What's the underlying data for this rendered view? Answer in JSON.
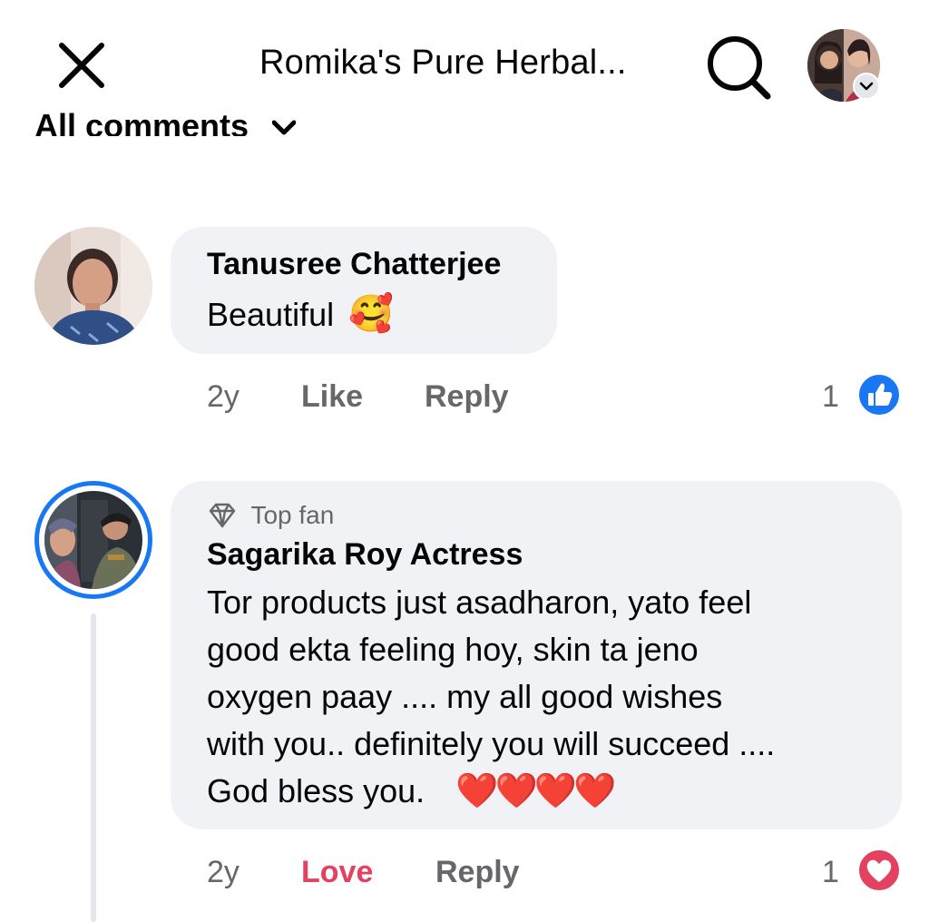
{
  "header": {
    "title": "Romika's Pure Herbal...",
    "filter_label": "All comments"
  },
  "comments": [
    {
      "author": "Tanusree Chatterjee",
      "text": "Beautiful",
      "emoji": "🥰",
      "time": "2y",
      "action": "Like",
      "reply": "Reply",
      "reaction_count": "1",
      "reaction": "like-icon"
    },
    {
      "badge": "Top fan",
      "author": "Sagarika Roy Actress",
      "lines": [
        "Tor products just asadharon,  yato feel",
        "good ekta feeling hoy, skin ta jeno",
        "oxygen paay .... my all good wishes",
        "with you.. definitely you will succeed  ....",
        "God bless you."
      ],
      "emoji": "❤️❤️❤️❤️",
      "time": "2y",
      "action": "Love",
      "reply": "Reply",
      "reaction_count": "1",
      "reaction": "heart-icon"
    }
  ],
  "colors": {
    "like_blue": "#1877f2",
    "love_red": "#e4405f",
    "bubble": "#f0f2f5",
    "meta_gray": "#65676b"
  }
}
